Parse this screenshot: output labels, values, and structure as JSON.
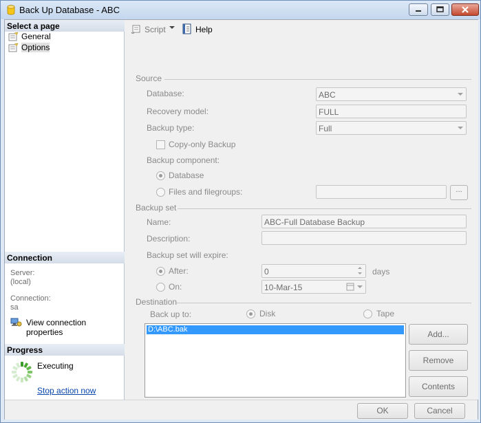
{
  "window": {
    "title": "Back Up Database - ABC"
  },
  "left": {
    "select_page_header": "Select a page",
    "pages": [
      {
        "label": "General"
      },
      {
        "label": "Options"
      }
    ],
    "connection_header": "Connection",
    "server_label": "Server:",
    "server_value": "(local)",
    "connection_label": "Connection:",
    "connection_value": "sa",
    "view_connection_link": "View connection properties",
    "progress_header": "Progress",
    "progress_status": "Executing",
    "stop_link": "Stop action now"
  },
  "toolbar": {
    "script_label": "Script",
    "help_label": "Help"
  },
  "source": {
    "group_label": "Source",
    "database_label": "Database:",
    "database_value": "ABC",
    "recovery_label": "Recovery model:",
    "recovery_value": "FULL",
    "backup_type_label": "Backup type:",
    "backup_type_value": "Full",
    "copy_only_label": "Copy-only Backup",
    "component_label": "Backup component:",
    "component_database": "Database",
    "component_files": "Files and filegroups:",
    "browse_button": "..."
  },
  "backup_set": {
    "group_label": "Backup set",
    "name_label": "Name:",
    "name_value": "ABC-Full Database Backup",
    "description_label": "Description:",
    "description_value": "",
    "expire_label": "Backup set will expire:",
    "after_label": "After:",
    "after_value": "0",
    "days_label": "days",
    "on_label": "On:",
    "on_value": "10-Mar-15"
  },
  "destination": {
    "group_label": "Destination",
    "back_up_to_label": "Back up to:",
    "disk_label": "Disk",
    "tape_label": "Tape",
    "list_items": [
      "D:\\ABC.bak"
    ],
    "add_button": "Add...",
    "remove_button": "Remove",
    "contents_button": "Contents"
  },
  "footer": {
    "ok_button": "OK",
    "cancel_button": "Cancel"
  },
  "colors": {
    "selection": "#3399ff",
    "title_gradient_top": "#dbe8f7",
    "link": "#0645ad"
  },
  "icons": [
    "database-icon",
    "page-icon",
    "script-icon",
    "help-icon",
    "connection-properties-icon",
    "progress-spinner-icon"
  ]
}
